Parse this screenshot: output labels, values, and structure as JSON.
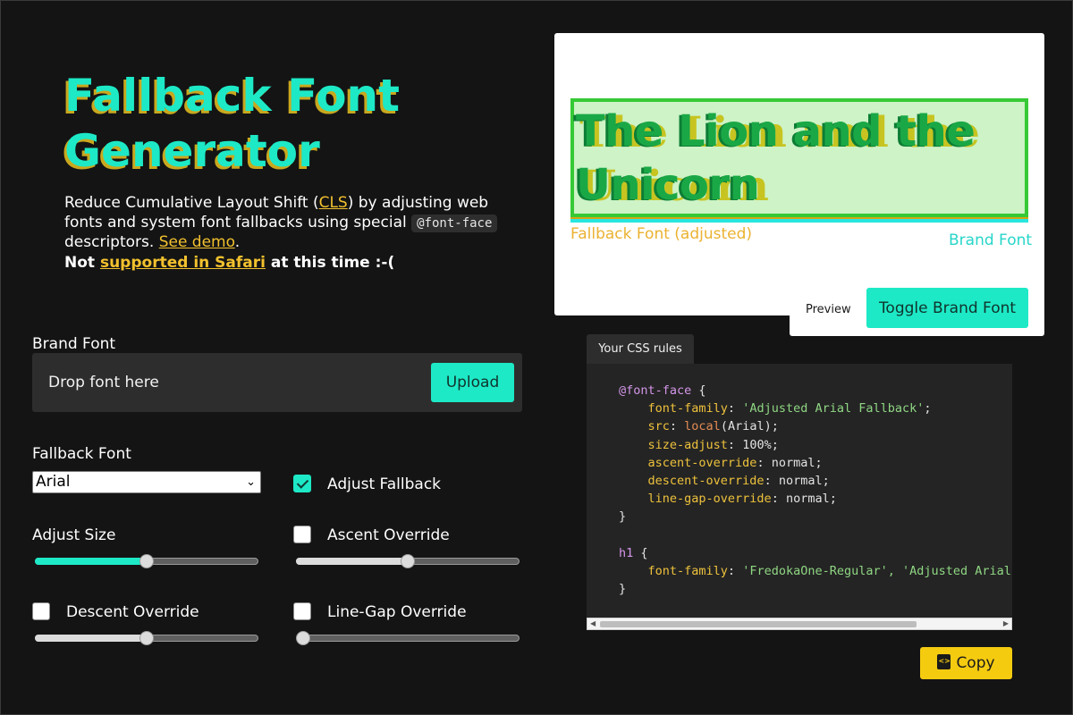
{
  "hero": {
    "title_line1": "Fallback Font",
    "title_line2": "Generator",
    "intro_part1": "Reduce Cumulative Layout Shift (",
    "cls_link": "CLS",
    "intro_part2": ") by adjusting web fonts and system font fallbacks using special ",
    "code_snippet": "@font-face",
    "intro_part3": " descriptors. ",
    "demo_link": "See demo",
    "intro_part4": ".",
    "warn_part1": "Not ",
    "safari_link": "supported in Safari",
    "warn_part2": " at this time :-("
  },
  "brand_font": {
    "label": "Brand Font",
    "drop_text": "Drop font here",
    "upload_label": "Upload"
  },
  "fallback_font": {
    "label": "Fallback Font",
    "selected": "Arial"
  },
  "options": {
    "adjust_fallback": {
      "label": "Adjust Fallback",
      "checked": true
    },
    "adjust_size": {
      "label": "Adjust Size",
      "value": 0.5
    },
    "ascent_override": {
      "label": "Ascent Override",
      "checked": false,
      "value": 0.5
    },
    "descent_override": {
      "label": "Descent Override",
      "checked": false,
      "value": 0.5
    },
    "line_gap_override": {
      "label": "Line-Gap Override",
      "checked": false,
      "value": 0.0
    }
  },
  "preview": {
    "sample_text": "The Lion and the Unicorn",
    "fallback_caption": "Fallback Font (adjusted)",
    "brand_caption": "Brand Font",
    "tab_label": "Preview",
    "toggle_label": "Toggle Brand Font"
  },
  "css_panel": {
    "tab_label": "Your CSS rules",
    "font_family_value": "'Adjusted Arial Fallback'",
    "src_fn": "local",
    "src_arg": "(Arial);",
    "size_adjust": "100%",
    "ascent_override": "normal",
    "descent_override": "normal",
    "line_gap_override": "normal",
    "h1_family": "'FredokaOne-Regular', 'Adjusted Arial",
    "copy_label": "Copy"
  },
  "colors": {
    "accent_teal": "#1de9c6",
    "accent_gold": "#c9a81e",
    "copy_yellow": "#f5cb10",
    "background": "#141414"
  }
}
